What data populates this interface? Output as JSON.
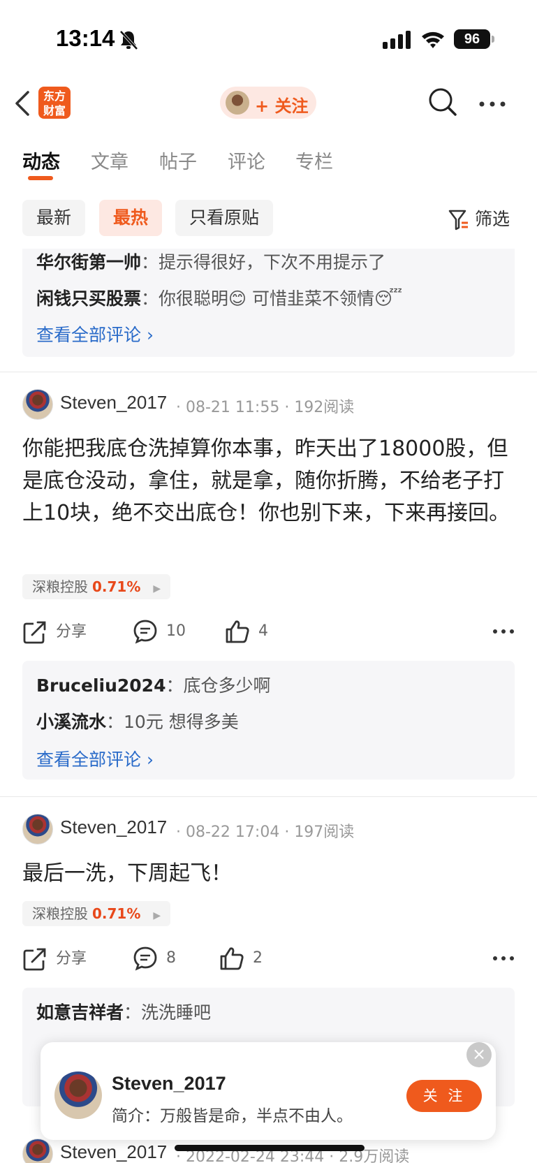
{
  "status_bar": {
    "time": "13:14",
    "battery": "96"
  },
  "header": {
    "brand_line1": "东方",
    "brand_line2": "财富",
    "follow_label": "+ 关注"
  },
  "tabs": [
    {
      "label": "动态",
      "active": true
    },
    {
      "label": "文章",
      "active": false
    },
    {
      "label": "帖子",
      "active": false
    },
    {
      "label": "评论",
      "active": false
    },
    {
      "label": "专栏",
      "active": false
    }
  ],
  "filters": {
    "chips": [
      "最新",
      "最热",
      "只看原贴"
    ],
    "active": "最热",
    "filter_label": "筛选"
  },
  "top_comments": {
    "items": [
      {
        "user": "华尔街第一帅",
        "text": "提示得很好，下次不用提示了"
      },
      {
        "user": "闲钱只买股票",
        "text": "你很聪明😊  可惜韭菜不领情😴"
      }
    ],
    "view_all": "查看全部评论"
  },
  "posts": [
    {
      "author": "Steven_2017",
      "date": "08-21 11:55",
      "reads": "192阅读",
      "text": "你能把我底仓洗掉算你本事，昨天出了18000股，但是底仓没动，拿住，就是拿，随你折腾，不给老子打上10块，绝不交出底仓！你也别下来，下来再接回。",
      "stock": {
        "name": "深粮控股",
        "change": "0.71%"
      },
      "actions": {
        "share": "分享",
        "comments": "10",
        "likes": "4"
      },
      "comments": [
        {
          "user": "Bruceliu2024",
          "text": "底仓多少啊"
        },
        {
          "user": "小溪流水",
          "text": "10元 想得多美"
        }
      ],
      "view_all": "查看全部评论"
    },
    {
      "author": "Steven_2017",
      "date": "08-22 17:04",
      "reads": "197阅读",
      "text": "最后一洗，下周起飞！",
      "stock": {
        "name": "深粮控股",
        "change": "0.71%"
      },
      "actions": {
        "share": "分享",
        "comments": "8",
        "likes": "2"
      },
      "comments": [
        {
          "user": "如意吉祥者",
          "text": "洗洗睡吧"
        }
      ]
    },
    {
      "author": "Steven_2017",
      "date": "2022-02-24 23:44",
      "reads": "2.9万阅读"
    }
  ],
  "profile_card": {
    "name": "Steven_2017",
    "bio": "简介：万般皆是命，半点不由人。",
    "follow_label": "关 注",
    "close": "×"
  }
}
